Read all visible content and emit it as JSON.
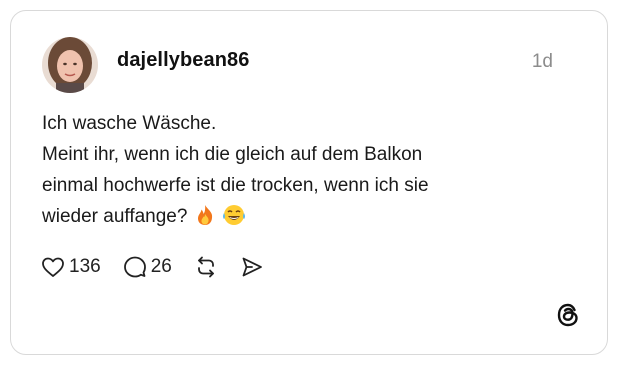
{
  "post": {
    "username": "dajellybean86",
    "timestamp": "1d",
    "text_lines": [
      "Ich wasche Wäsche.",
      "Meint ihr, wenn ich die gleich auf dem Balkon",
      "einmal hochwerfe ist die trocken, wenn ich sie",
      "wieder auffange?"
    ],
    "emojis": [
      "fire-emoji",
      "tears-of-joy-emoji"
    ]
  },
  "actions": {
    "likes": "136",
    "replies": "26",
    "icons": [
      "heart-icon",
      "comment-icon",
      "repost-icon",
      "share-icon"
    ]
  },
  "brand": {
    "logo": "threads-logo-icon"
  },
  "colors": {
    "border": "#d9d9d9",
    "text": "#111111",
    "muted": "#8c8c8c"
  }
}
